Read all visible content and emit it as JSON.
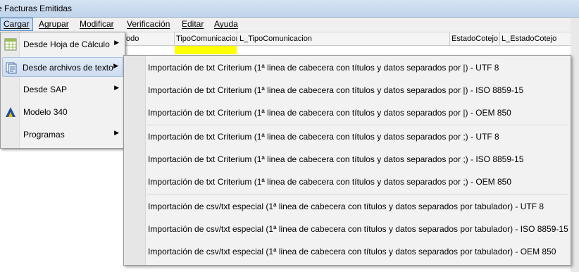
{
  "window": {
    "title": "e Facturas Emitidas"
  },
  "menubar": {
    "items": [
      "Cargar",
      "Agrupar",
      "Modificar",
      "Verificación",
      "Editar",
      "Ayuda"
    ]
  },
  "grid": {
    "columns": [
      "odo",
      "TipoComunicacion",
      "L_TipoComunicacion",
      "EstadoCotejo",
      "L_EstadoCotejo"
    ],
    "highlight_color": "#ffff00"
  },
  "cargar_menu": {
    "items": [
      {
        "label": "Desde Hoja de Cálculo",
        "icon": "spreadsheet-icon",
        "has_submenu": true
      },
      {
        "label": "Desde archivos de texto",
        "icon": "text-files-icon",
        "has_submenu": true
      },
      {
        "label": "Desde SAP",
        "icon": "",
        "has_submenu": true
      },
      {
        "label": "Modelo 340",
        "icon": "tax-agency-logo-icon",
        "has_submenu": false
      },
      {
        "label": "Programas",
        "icon": "",
        "has_submenu": true
      }
    ]
  },
  "text_submenu": {
    "items": [
      "Importación de txt Criterium (1ª linea de cabecera con títulos y datos separados por |) - UTF 8",
      "Importación de txt Criterium (1ª linea de cabecera con títulos y datos separados por |) - ISO 8859-15",
      "Importación de txt Criterium (1ª linea de cabecera con títulos y datos separados por |) - OEM 850",
      "Importación de txt Criterium (1ª linea de cabecera con títulos y datos separados por ;) - UTF 8",
      "Importación de txt Criterium (1ª linea de cabecera con títulos y datos separados por ;) - ISO 8859-15",
      "Importación de txt Criterium (1ª linea de cabecera con títulos y datos separados por ;) - OEM 850",
      "Importación de csv/txt especial (1ª linea de cabecera con títulos y datos separados por tabulador) - UTF 8",
      "Importación de csv/txt especial (1ª linea de cabecera con títulos y datos separados por tabulador) - ISO 8859-15",
      "Importación de csv/txt especial (1ª linea de cabecera con títulos y datos separados por tabulador) - OEM 850"
    ]
  }
}
